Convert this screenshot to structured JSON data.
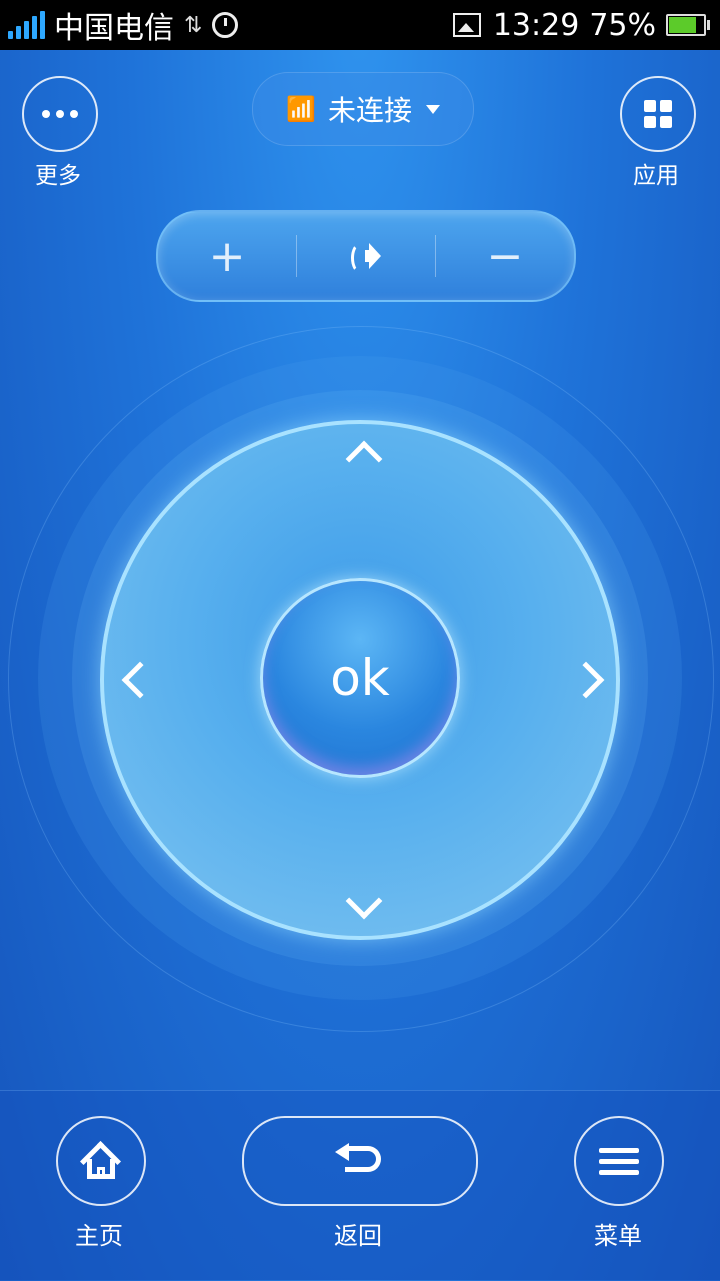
{
  "status_bar": {
    "carrier": "中国电信",
    "time": "13:29",
    "battery_percent": "75%",
    "battery_level": 0.75,
    "icons": [
      "signal-icon",
      "data-transfer-icon",
      "alarm-icon",
      "image-notification-icon",
      "battery-icon"
    ]
  },
  "top": {
    "more_label": "更多",
    "apps_label": "应用",
    "connection_status": "未连接"
  },
  "volume": {
    "plus": "+",
    "minus": "−"
  },
  "dpad": {
    "ok_label": "ok"
  },
  "bottom": {
    "home_label": "主页",
    "back_label": "返回",
    "menu_label": "菜单"
  },
  "colors": {
    "background": "#1f73d9",
    "dpad_border": "#a9e2ff",
    "battery_fill": "#5ccb2a",
    "signal": "#2ea8ff"
  }
}
